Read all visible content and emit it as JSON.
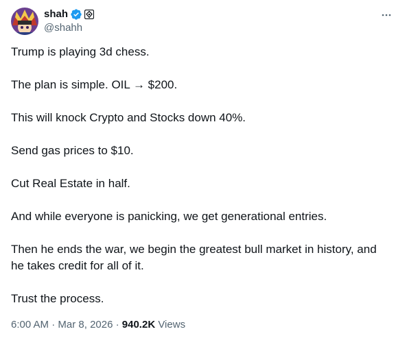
{
  "author": {
    "display_name": "shah",
    "handle": "@shahh",
    "avatar_icon": "anime-character-avatar",
    "verified_icon": "verified-badge-icon",
    "verified_color": "#1d9bf0",
    "affiliate_icon": "affiliate-badge-icon"
  },
  "more_icon": "more-options-icon",
  "tweet": {
    "paragraphs": [
      "Trump is playing 3d chess.",
      "The plan is simple. OIL → $200.",
      "This will knock Crypto and Stocks down 40%.",
      "Send gas prices to $10.",
      "Cut Real Estate in half.",
      "And while everyone is panicking, we get generational entries.",
      "Then he ends the war, we begin the greatest bull market in history, and he takes credit for all of it.",
      "Trust the process."
    ]
  },
  "meta": {
    "time": "6:00 AM",
    "separator": " · ",
    "date": "Mar 8, 2026",
    "views_count": "940.2K",
    "views_label": " Views"
  },
  "colors": {
    "text": "#0f1419",
    "secondary": "#536471",
    "accent": "#1d9bf0"
  }
}
